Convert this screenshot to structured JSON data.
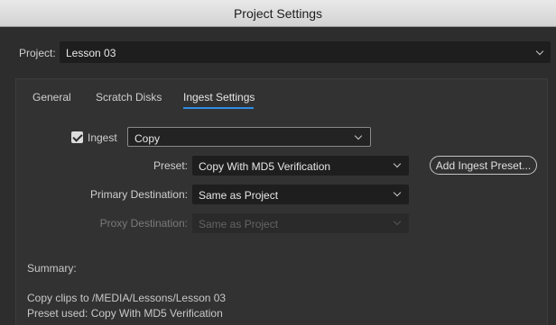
{
  "window": {
    "title": "Project Settings"
  },
  "project": {
    "label": "Project:",
    "value": "Lesson 03"
  },
  "tabs": [
    {
      "label": "General",
      "active": false
    },
    {
      "label": "Scratch Disks",
      "active": false
    },
    {
      "label": "Ingest Settings",
      "active": true
    }
  ],
  "ingest": {
    "checkbox_label": "Ingest",
    "checked": true,
    "mode_value": "Copy",
    "preset_label": "Preset:",
    "preset_value": "Copy With MD5 Verification",
    "add_preset_button": "Add Ingest Preset...",
    "primary_label": "Primary Destination:",
    "primary_value": "Same as Project",
    "proxy_label": "Proxy Destination:",
    "proxy_value": "Same as Project"
  },
  "summary": {
    "label": "Summary:",
    "lines": [
      "Copy clips to /MEDIA/Lessons/Lesson 03",
      "Preset used: Copy With MD5 Verification"
    ]
  },
  "colors": {
    "accent": "#2f8de4",
    "background": "#2d2d2d",
    "field": "#1e1e1e"
  },
  "icons": {
    "dropdown": "chevron-down-icon",
    "check": "checkmark-icon"
  }
}
